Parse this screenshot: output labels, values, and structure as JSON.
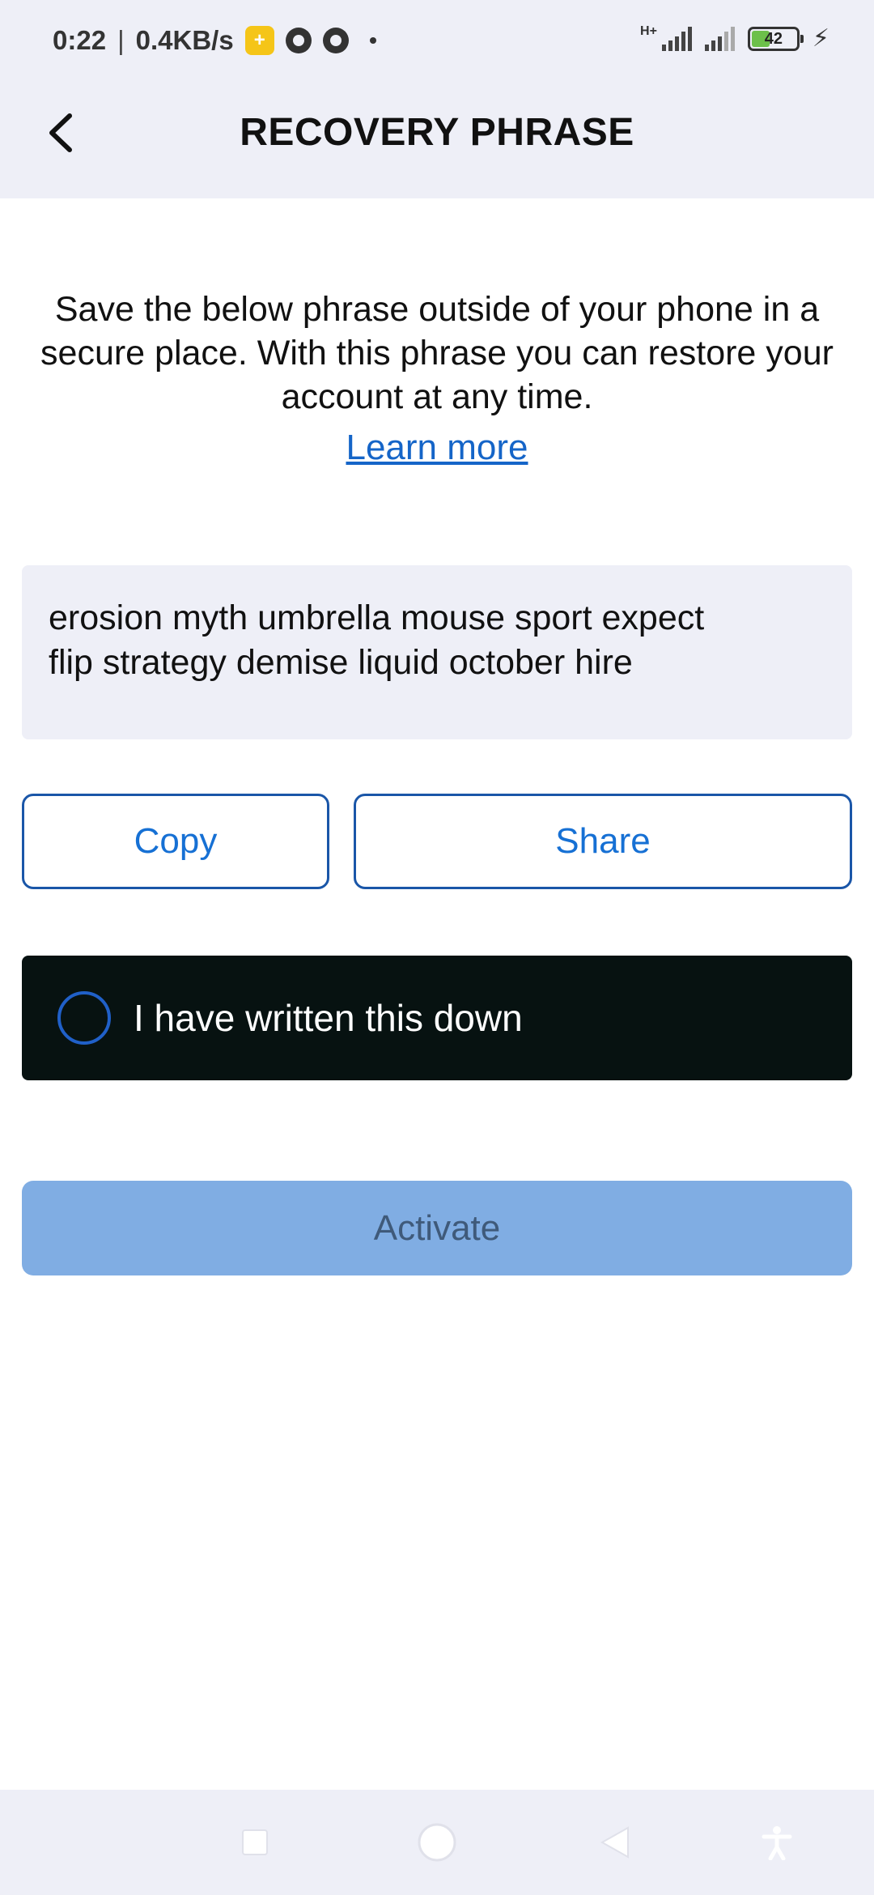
{
  "status_bar": {
    "time": "0:22",
    "network_speed": "0.4KB/s",
    "network_type": "H+",
    "battery_level": "42"
  },
  "header": {
    "title": "RECOVERY PHRASE"
  },
  "intro": {
    "lines": [
      "Save the below phrase outside of your phone in a",
      "secure place. With this phrase you can restore your",
      "account at any time."
    ],
    "learn_more": "Learn more"
  },
  "phrase": {
    "lines": [
      "erosion myth umbrella mouse sport expect",
      "flip strategy demise liquid october hire"
    ]
  },
  "actions": {
    "copy_label": "Copy",
    "share_label": "Share"
  },
  "confirm": {
    "label": "I have written this down",
    "checked": false
  },
  "activate": {
    "label": "Activate",
    "enabled": false
  },
  "colors": {
    "accent": "#1670d4",
    "header_bg": "#eeeff7",
    "confirm_bg": "#071211",
    "activate_disabled_bg": "#80ade3"
  }
}
